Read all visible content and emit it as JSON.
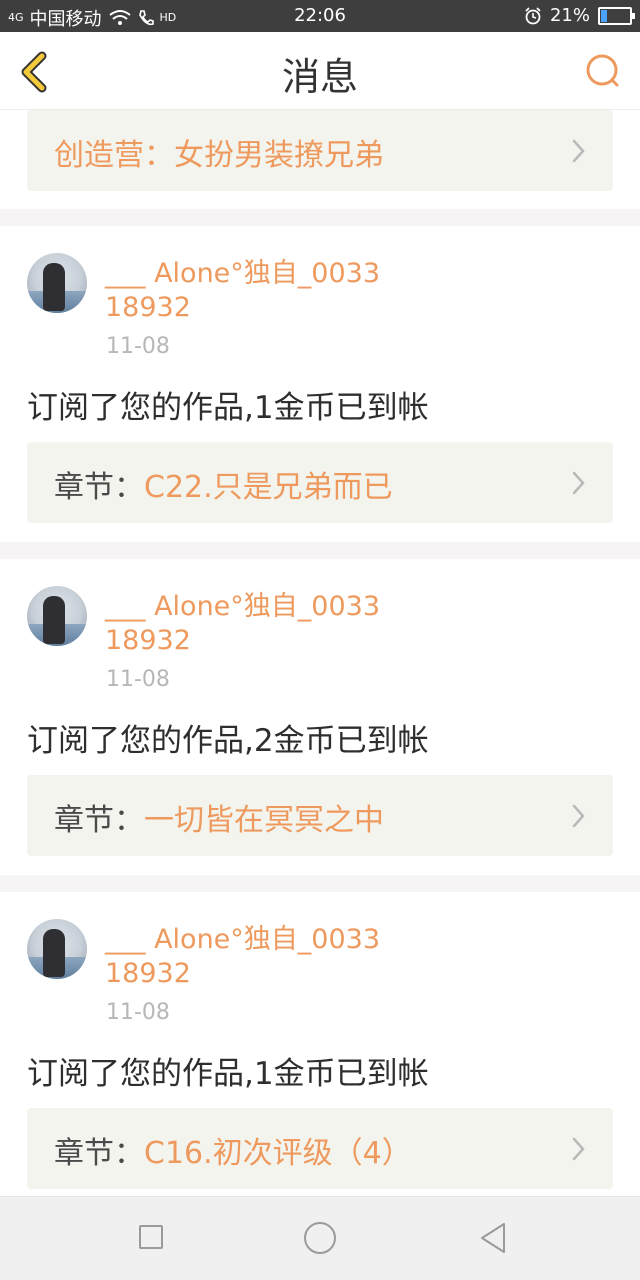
{
  "status_bar": {
    "signal_label": "4G",
    "carrier": "中国移动",
    "hd_label": "HD",
    "time": "22:06",
    "battery_percent": "21%",
    "battery_level": 0.21
  },
  "header": {
    "title": "消息"
  },
  "top_card": {
    "chapter_title": "创造营：女扮男装撩兄弟"
  },
  "messages": [
    {
      "username": "___ Alone°独自_003318932",
      "date": "11-08",
      "text": "订阅了您的作品,1金币已到帐",
      "chapter_prefix": "章节：",
      "chapter_title": "C22.只是兄弟而已"
    },
    {
      "username": "___ Alone°独自_003318932",
      "date": "11-08",
      "text": "订阅了您的作品,2金币已到帐",
      "chapter_prefix": "章节：",
      "chapter_title": "一切皆在冥冥之中"
    },
    {
      "username": "___ Alone°独自_003318932",
      "date": "11-08",
      "text": "订阅了您的作品,1金币已到帐",
      "chapter_prefix": "章节：",
      "chapter_title": "C16.初次评级（4）"
    }
  ],
  "colors": {
    "accent": "#ee9a5e",
    "background": "#f6f4f4",
    "chapter_box": "#f4f4ee",
    "status_bar": "#3e3e3e",
    "back_arrow": "#f5c93a"
  },
  "icons": {
    "back": "chevron-left-icon",
    "search": "search-icon",
    "chapter": "chevron-right-icon",
    "nav_recent": "square-icon",
    "nav_home": "circle-icon",
    "nav_back": "triangle-left-icon"
  }
}
